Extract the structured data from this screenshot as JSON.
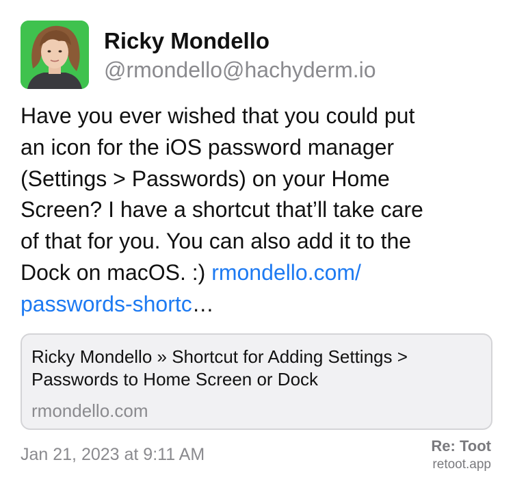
{
  "author": {
    "display_name": "Ricky Mondello",
    "handle": "@rmondello@hachyderm.io"
  },
  "post": {
    "lines": [
      "Have you ever wished that you could put",
      "an icon for the iOS password manager",
      "(Settings > Passwords) on your Home",
      "Screen? I have a shortcut that’ll take care",
      "of that for you. You can also add it to the"
    ],
    "line6_text": "Dock on macOS. :) ",
    "link_part1": "rmondello.com/",
    "link_part2": "passwords-shortc",
    "ellipsis": "…"
  },
  "link_card": {
    "title_lines": [
      "Ricky Mondello  » Shortcut for Adding Settings >",
      "Passwords to Home Screen or Dock"
    ],
    "domain": "rmondello.com"
  },
  "footer": {
    "timestamp": "Jan 21, 2023 at 9:11 AM",
    "brand_name": "Re: Toot",
    "brand_url": "retoot.app"
  },
  "colors": {
    "link": "#1d7af2",
    "secondary_text": "#8a8a8e",
    "avatar_background": "#3fc24e",
    "card_background": "#f1f1f3"
  }
}
